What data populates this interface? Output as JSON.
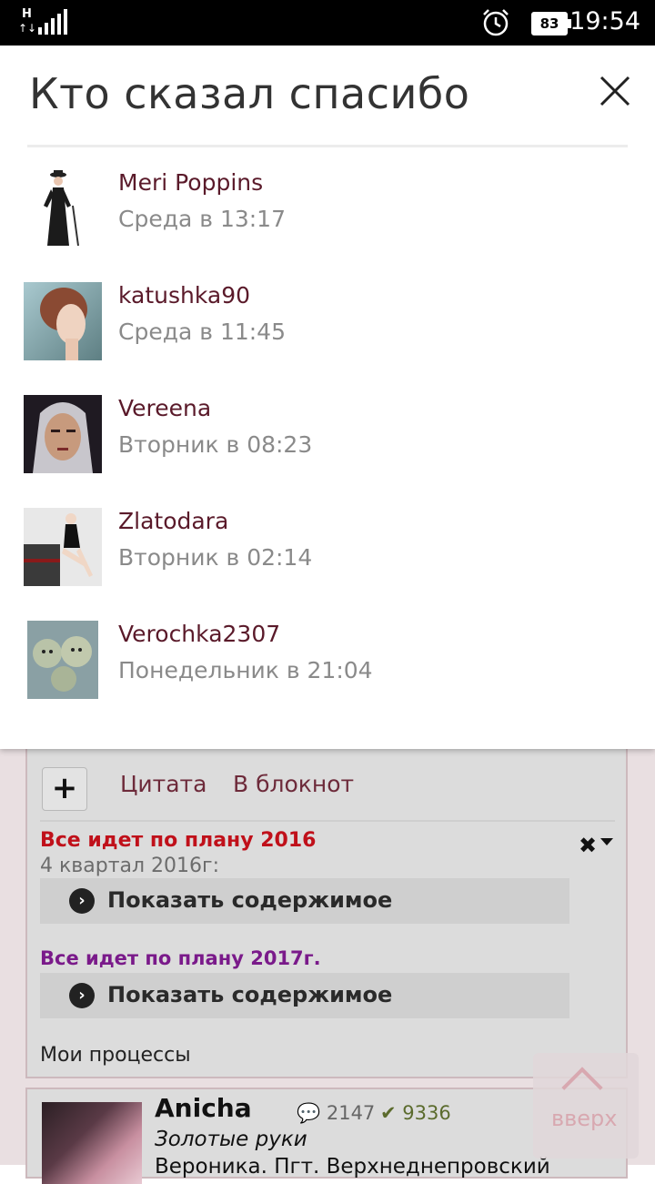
{
  "status_bar": {
    "network": "H",
    "battery": "83",
    "time": "19:54"
  },
  "modal": {
    "title": "Кто сказал спасибо",
    "users": [
      {
        "name": "Meri Poppins",
        "time": "Среда в 13:17"
      },
      {
        "name": "katushka90",
        "time": "Среда в 11:45"
      },
      {
        "name": "Vereena",
        "time": "Вторник в 08:23"
      },
      {
        "name": "Zlatodara",
        "time": "Вторник в 02:14"
      },
      {
        "name": "Verochka2307",
        "time": "Понедельник в 21:04"
      }
    ]
  },
  "background": {
    "actions": {
      "quote": "Цитата",
      "notebook": "В блокнот"
    },
    "plan_2016": {
      "title": "Все идет по плану 2016",
      "subtitle": "4 квартал 2016г:",
      "show": "Показать содержимое"
    },
    "plan_2017": {
      "title": "Все идет по плану 2017г.",
      "show": "Показать содержимое"
    },
    "processes": "Мои процессы",
    "post": {
      "author": "Anicha",
      "comments": "2147",
      "likes": "9336",
      "status": "Золотые руки",
      "location": "Вероника. Пгт. Верхнеднепровский"
    },
    "up_label": "вверх"
  },
  "colors": {
    "username": "#5a1a2a",
    "plan_2016_title": "#c0101a",
    "plan_2017_title": "#7a1a8a",
    "link": "#6d2a3a"
  }
}
